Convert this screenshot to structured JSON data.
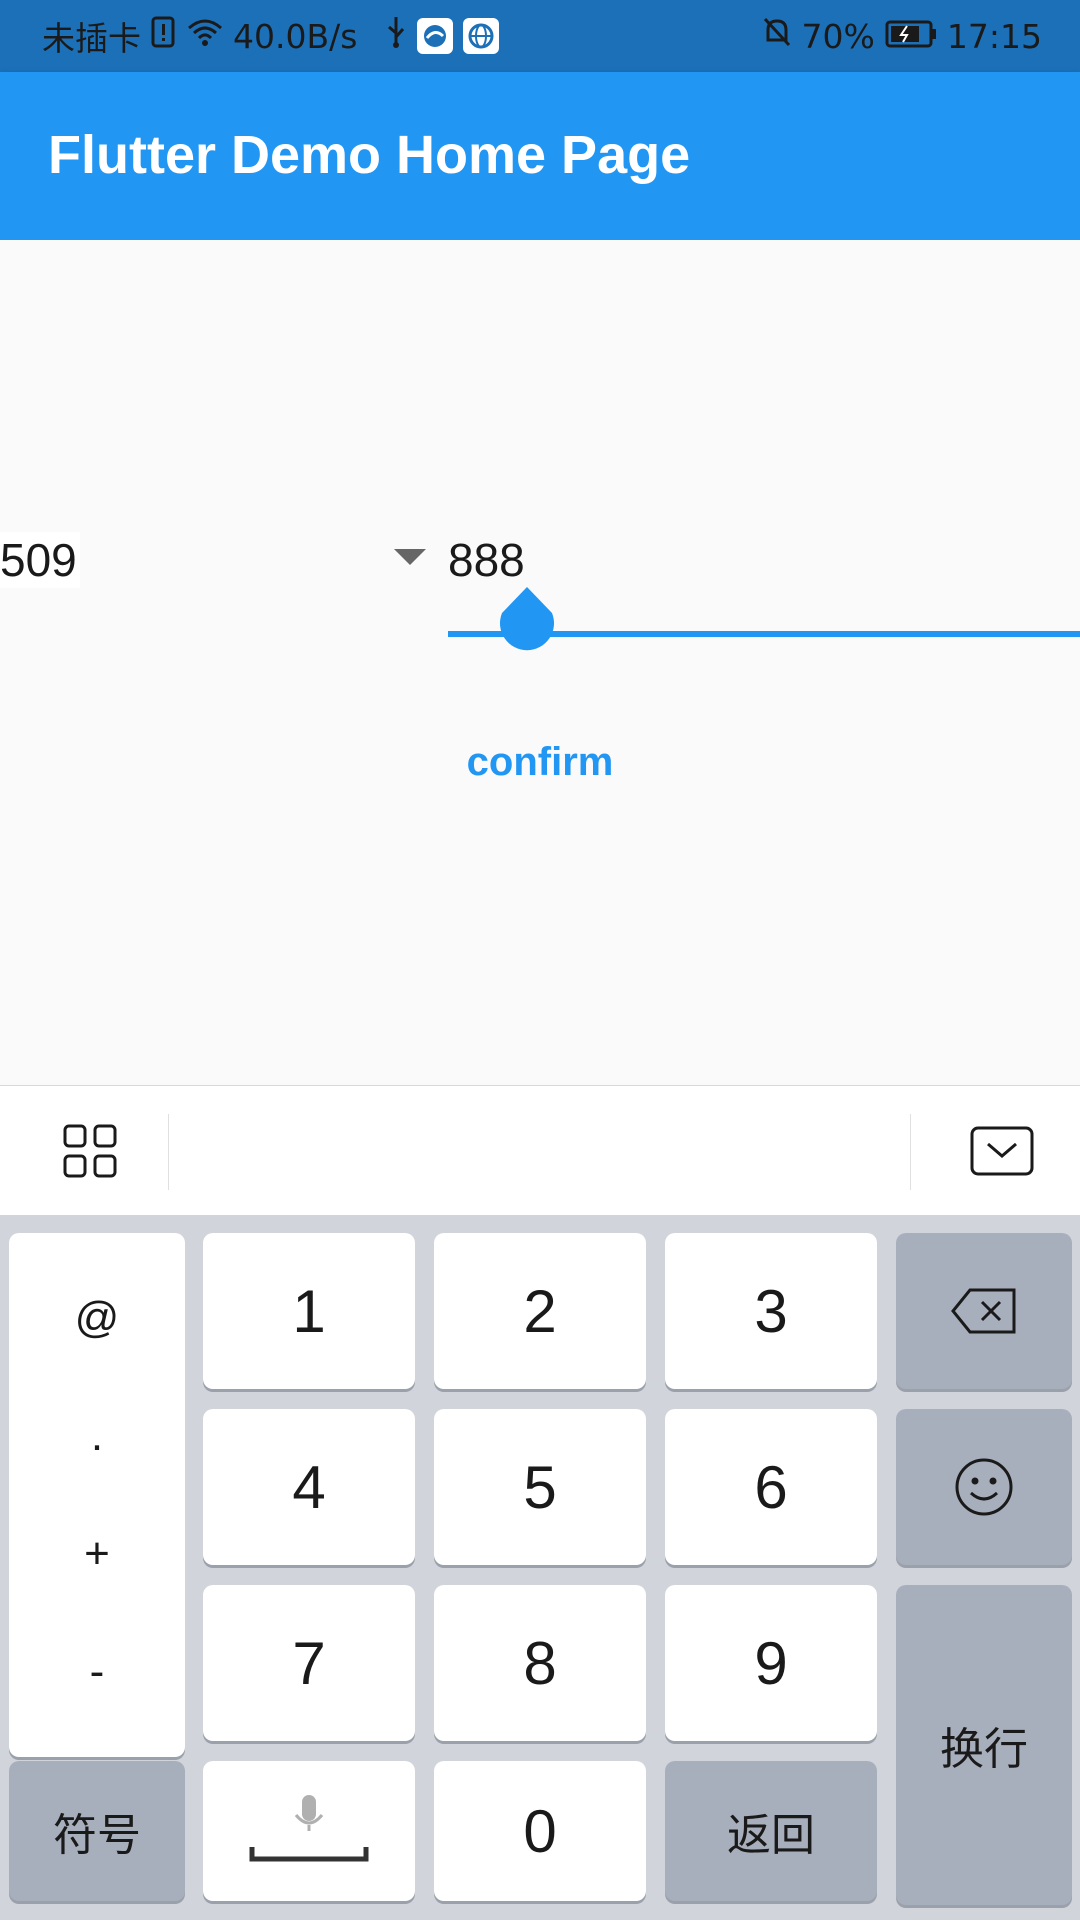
{
  "status_bar": {
    "carrier": "未插卡",
    "speed": "40.0B/s",
    "battery": "70%",
    "time": "17:15"
  },
  "app_bar": {
    "title": "Flutter Demo Home Page"
  },
  "main": {
    "left_value": "509",
    "right_value": "888",
    "confirm_label": "confirm",
    "slider_value": 888
  },
  "fab": {
    "label": "+"
  },
  "keyboard": {
    "symbols": [
      "@",
      ".",
      "+",
      "-"
    ],
    "digits": [
      "1",
      "2",
      "3",
      "4",
      "5",
      "6",
      "7",
      "8",
      "9",
      "0"
    ],
    "newline_label": "换行",
    "symbols_label": "符号",
    "back_label": "返回"
  },
  "colors": {
    "primary": "#2196f3",
    "status_bar": "#1c70b8",
    "keyboard_bg": "#d1d4db",
    "key_dark": "#a8afbc"
  }
}
